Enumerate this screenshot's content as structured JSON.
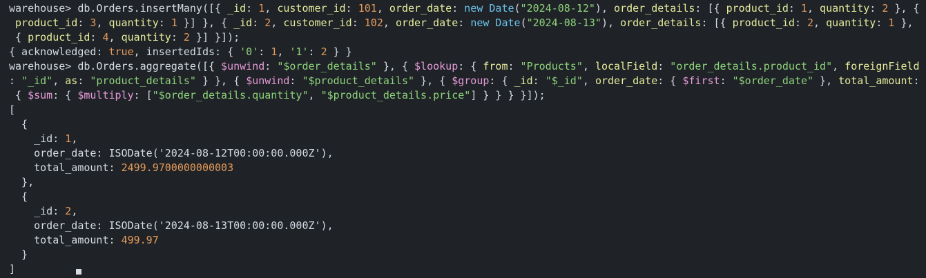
{
  "colors": {
    "background": "#1f2328",
    "default": "#d5dbe3",
    "key": "#e6eb9b",
    "string": "#8ed27a",
    "number": "#e59a5a",
    "operator": "#e59ad6",
    "keyword": "#6bc1e8",
    "boolean": "#e59a5a"
  },
  "terminal": {
    "lines": [
      [
        {
          "t": "warehouse> db.Orders.insertMany([{ ",
          "c": "default"
        },
        {
          "t": "_id",
          "c": "key"
        },
        {
          "t": ": ",
          "c": "default"
        },
        {
          "t": "1",
          "c": "number"
        },
        {
          "t": ", ",
          "c": "default"
        },
        {
          "t": "customer_id",
          "c": "key"
        },
        {
          "t": ": ",
          "c": "default"
        },
        {
          "t": "101",
          "c": "number"
        },
        {
          "t": ", ",
          "c": "default"
        },
        {
          "t": "order_date",
          "c": "key"
        },
        {
          "t": ": ",
          "c": "default"
        },
        {
          "t": "new Date",
          "c": "keyword"
        },
        {
          "t": "(",
          "c": "default"
        },
        {
          "t": "\"2024-08-12\"",
          "c": "string"
        },
        {
          "t": "), ",
          "c": "default"
        },
        {
          "t": "order_details",
          "c": "key"
        },
        {
          "t": ": [{ ",
          "c": "default"
        },
        {
          "t": "product_id",
          "c": "key"
        },
        {
          "t": ": ",
          "c": "default"
        },
        {
          "t": "1",
          "c": "number"
        },
        {
          "t": ", ",
          "c": "default"
        },
        {
          "t": "quantity",
          "c": "key"
        },
        {
          "t": ": ",
          "c": "default"
        },
        {
          "t": "2",
          "c": "number"
        },
        {
          "t": " }, {",
          "c": "default"
        }
      ],
      [
        {
          "t": " ",
          "c": "default"
        },
        {
          "t": "product_id",
          "c": "key"
        },
        {
          "t": ": ",
          "c": "default"
        },
        {
          "t": "3",
          "c": "number"
        },
        {
          "t": ", ",
          "c": "default"
        },
        {
          "t": "quantity",
          "c": "key"
        },
        {
          "t": ": ",
          "c": "default"
        },
        {
          "t": "1",
          "c": "number"
        },
        {
          "t": " }] }, { ",
          "c": "default"
        },
        {
          "t": "_id",
          "c": "key"
        },
        {
          "t": ": ",
          "c": "default"
        },
        {
          "t": "2",
          "c": "number"
        },
        {
          "t": ", ",
          "c": "default"
        },
        {
          "t": "customer_id",
          "c": "key"
        },
        {
          "t": ": ",
          "c": "default"
        },
        {
          "t": "102",
          "c": "number"
        },
        {
          "t": ", ",
          "c": "default"
        },
        {
          "t": "order_date",
          "c": "key"
        },
        {
          "t": ": ",
          "c": "default"
        },
        {
          "t": "new Date",
          "c": "keyword"
        },
        {
          "t": "(",
          "c": "default"
        },
        {
          "t": "\"2024-08-13\"",
          "c": "string"
        },
        {
          "t": "), ",
          "c": "default"
        },
        {
          "t": "order_details",
          "c": "key"
        },
        {
          "t": ": [{ ",
          "c": "default"
        },
        {
          "t": "product_id",
          "c": "key"
        },
        {
          "t": ": ",
          "c": "default"
        },
        {
          "t": "2",
          "c": "number"
        },
        {
          "t": ", ",
          "c": "default"
        },
        {
          "t": "quantity",
          "c": "key"
        },
        {
          "t": ": ",
          "c": "default"
        },
        {
          "t": "1",
          "c": "number"
        },
        {
          "t": " },",
          "c": "default"
        }
      ],
      [
        {
          "t": " { ",
          "c": "default"
        },
        {
          "t": "product_id",
          "c": "key"
        },
        {
          "t": ": ",
          "c": "default"
        },
        {
          "t": "4",
          "c": "number"
        },
        {
          "t": ", ",
          "c": "default"
        },
        {
          "t": "quantity",
          "c": "key"
        },
        {
          "t": ": ",
          "c": "default"
        },
        {
          "t": "2",
          "c": "number"
        },
        {
          "t": " }] }]);",
          "c": "default"
        }
      ],
      [
        {
          "t": "{ acknowledged: ",
          "c": "default"
        },
        {
          "t": "true",
          "c": "boolean"
        },
        {
          "t": ", insertedIds: { ",
          "c": "default"
        },
        {
          "t": "'0'",
          "c": "string"
        },
        {
          "t": ": ",
          "c": "default"
        },
        {
          "t": "1",
          "c": "number"
        },
        {
          "t": ", ",
          "c": "default"
        },
        {
          "t": "'1'",
          "c": "string"
        },
        {
          "t": ": ",
          "c": "default"
        },
        {
          "t": "2",
          "c": "number"
        },
        {
          "t": " } }",
          "c": "default"
        }
      ],
      [
        {
          "t": "warehouse> db.Orders.aggregate([{ ",
          "c": "default"
        },
        {
          "t": "$unwind",
          "c": "operator"
        },
        {
          "t": ": ",
          "c": "default"
        },
        {
          "t": "\"$order_details\"",
          "c": "string"
        },
        {
          "t": " }, { ",
          "c": "default"
        },
        {
          "t": "$lookup",
          "c": "operator"
        },
        {
          "t": ": { ",
          "c": "default"
        },
        {
          "t": "from",
          "c": "key"
        },
        {
          "t": ": ",
          "c": "default"
        },
        {
          "t": "\"Products\"",
          "c": "string"
        },
        {
          "t": ", ",
          "c": "default"
        },
        {
          "t": "localField",
          "c": "key"
        },
        {
          "t": ": ",
          "c": "default"
        },
        {
          "t": "\"order_details.product_id\"",
          "c": "string"
        },
        {
          "t": ", ",
          "c": "default"
        },
        {
          "t": "foreignField",
          "c": "key"
        }
      ],
      [
        {
          "t": ": ",
          "c": "default"
        },
        {
          "t": "\"_id\"",
          "c": "string"
        },
        {
          "t": ", ",
          "c": "default"
        },
        {
          "t": "as",
          "c": "key"
        },
        {
          "t": ": ",
          "c": "default"
        },
        {
          "t": "\"product_details\"",
          "c": "string"
        },
        {
          "t": " } }, { ",
          "c": "default"
        },
        {
          "t": "$unwind",
          "c": "operator"
        },
        {
          "t": ": ",
          "c": "default"
        },
        {
          "t": "\"$product_details\"",
          "c": "string"
        },
        {
          "t": " }, { ",
          "c": "default"
        },
        {
          "t": "$group",
          "c": "operator"
        },
        {
          "t": ": { ",
          "c": "default"
        },
        {
          "t": "_id",
          "c": "key"
        },
        {
          "t": ": ",
          "c": "default"
        },
        {
          "t": "\"$_id\"",
          "c": "string"
        },
        {
          "t": ", ",
          "c": "default"
        },
        {
          "t": "order_date",
          "c": "key"
        },
        {
          "t": ": { ",
          "c": "default"
        },
        {
          "t": "$first",
          "c": "operator"
        },
        {
          "t": ": ",
          "c": "default"
        },
        {
          "t": "\"$order_date\"",
          "c": "string"
        },
        {
          "t": " }, ",
          "c": "default"
        },
        {
          "t": "total_amount",
          "c": "key"
        },
        {
          "t": ":",
          "c": "default"
        }
      ],
      [
        {
          "t": " { ",
          "c": "default"
        },
        {
          "t": "$sum",
          "c": "operator"
        },
        {
          "t": ": { ",
          "c": "default"
        },
        {
          "t": "$multiply",
          "c": "operator"
        },
        {
          "t": ": [",
          "c": "default"
        },
        {
          "t": "\"$order_details.quantity\"",
          "c": "string"
        },
        {
          "t": ", ",
          "c": "default"
        },
        {
          "t": "\"$product_details.price\"",
          "c": "string"
        },
        {
          "t": "] } } } }]);",
          "c": "default"
        }
      ],
      [
        {
          "t": "[",
          "c": "default"
        }
      ],
      [
        {
          "t": "  {",
          "c": "default"
        }
      ],
      [
        {
          "t": "    _id: ",
          "c": "default"
        },
        {
          "t": "1",
          "c": "number"
        },
        {
          "t": ",",
          "c": "default"
        }
      ],
      [
        {
          "t": "    order_date: ISODate(",
          "c": "default"
        },
        {
          "t": "'2024-08-12T00:00:00.000Z'",
          "c": "default"
        },
        {
          "t": "),",
          "c": "default"
        }
      ],
      [
        {
          "t": "    total_amount: ",
          "c": "default"
        },
        {
          "t": "2499.9700000000003",
          "c": "number"
        }
      ],
      [
        {
          "t": "  },",
          "c": "default"
        }
      ],
      [
        {
          "t": "  {",
          "c": "default"
        }
      ],
      [
        {
          "t": "    _id: ",
          "c": "default"
        },
        {
          "t": "2",
          "c": "number"
        },
        {
          "t": ",",
          "c": "default"
        }
      ],
      [
        {
          "t": "    order_date: ISODate(",
          "c": "default"
        },
        {
          "t": "'2024-08-13T00:00:00.000Z'",
          "c": "default"
        },
        {
          "t": "),",
          "c": "default"
        }
      ],
      [
        {
          "t": "    total_amount: ",
          "c": "default"
        },
        {
          "t": "499.97",
          "c": "number"
        }
      ],
      [
        {
          "t": "  }",
          "c": "default"
        }
      ],
      [
        {
          "t": "]",
          "c": "default"
        }
      ]
    ]
  }
}
